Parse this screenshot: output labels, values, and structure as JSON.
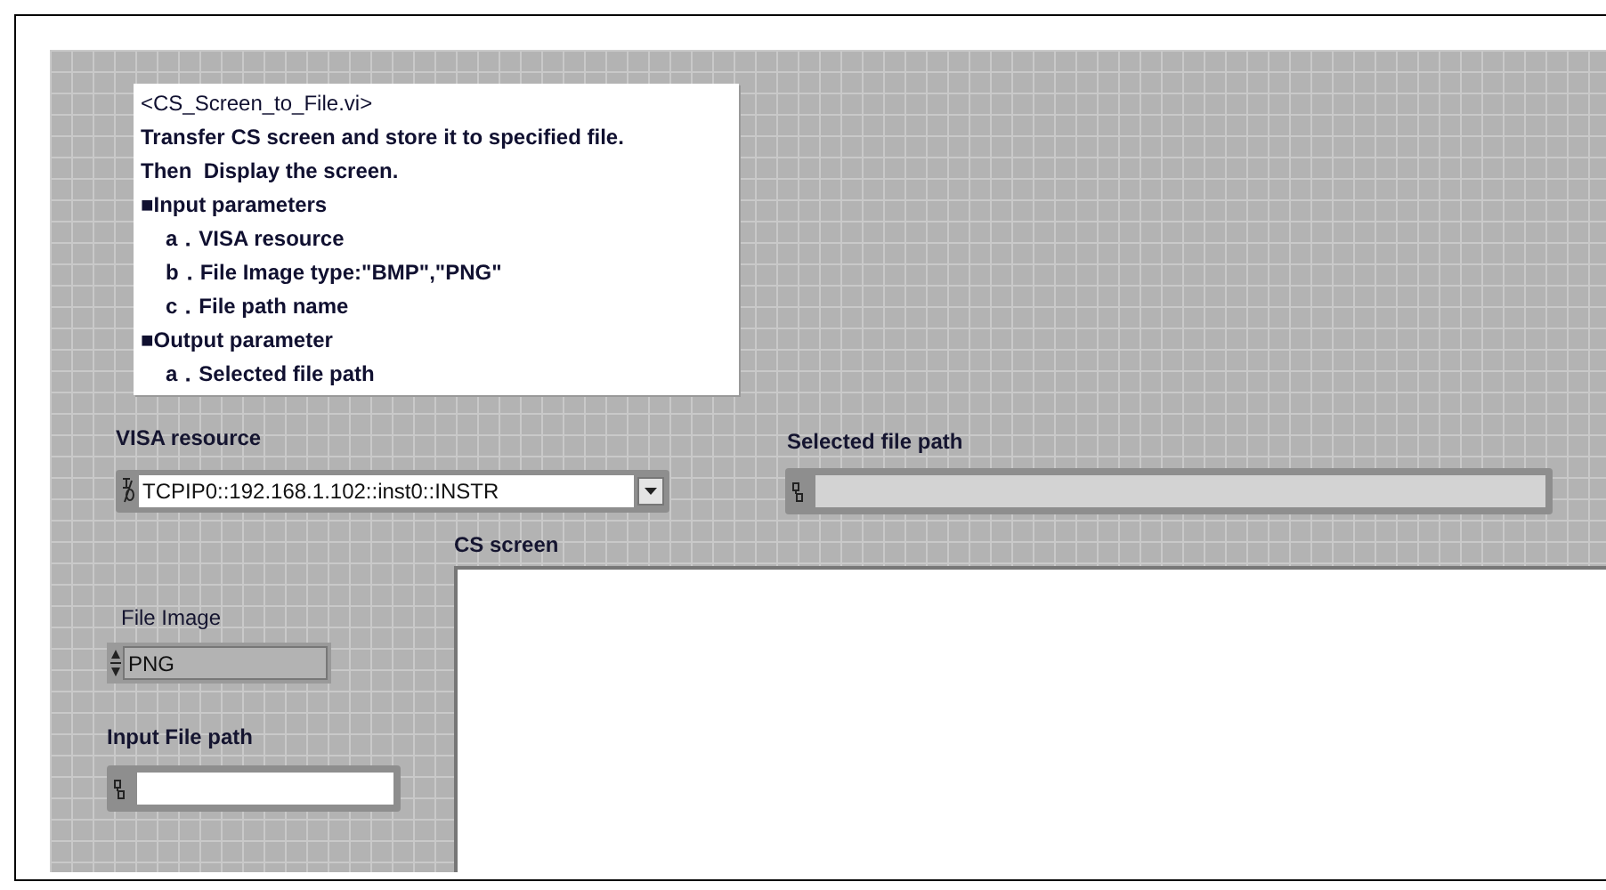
{
  "comment": {
    "lines": [
      {
        "kind": "title",
        "text": "<CS_Screen_to_File.vi>"
      },
      {
        "kind": "text",
        "text": "Transfer CS screen and store it to specified file."
      },
      {
        "kind": "text",
        "text": "Then  Display the screen."
      },
      {
        "kind": "heading",
        "text": "■Input parameters"
      },
      {
        "kind": "item",
        "text": "a．VISA resource"
      },
      {
        "kind": "item",
        "text": "b．File Image type:\"BMP\",\"PNG\""
      },
      {
        "kind": "item",
        "text": "c．File path name"
      },
      {
        "kind": "heading",
        "text": "■Output parameter"
      },
      {
        "kind": "item",
        "text": "a．Selected file path"
      }
    ]
  },
  "visa_resource": {
    "label": "VISA resource",
    "value": "TCPIP0::192.168.1.102::inst0::INSTR"
  },
  "selected_file_path": {
    "label": "Selected file path"
  },
  "cs_screen": {
    "label": "CS screen"
  },
  "file_image": {
    "label": "File Image",
    "value": "PNG"
  },
  "input_file_path": {
    "label": "Input File path"
  }
}
